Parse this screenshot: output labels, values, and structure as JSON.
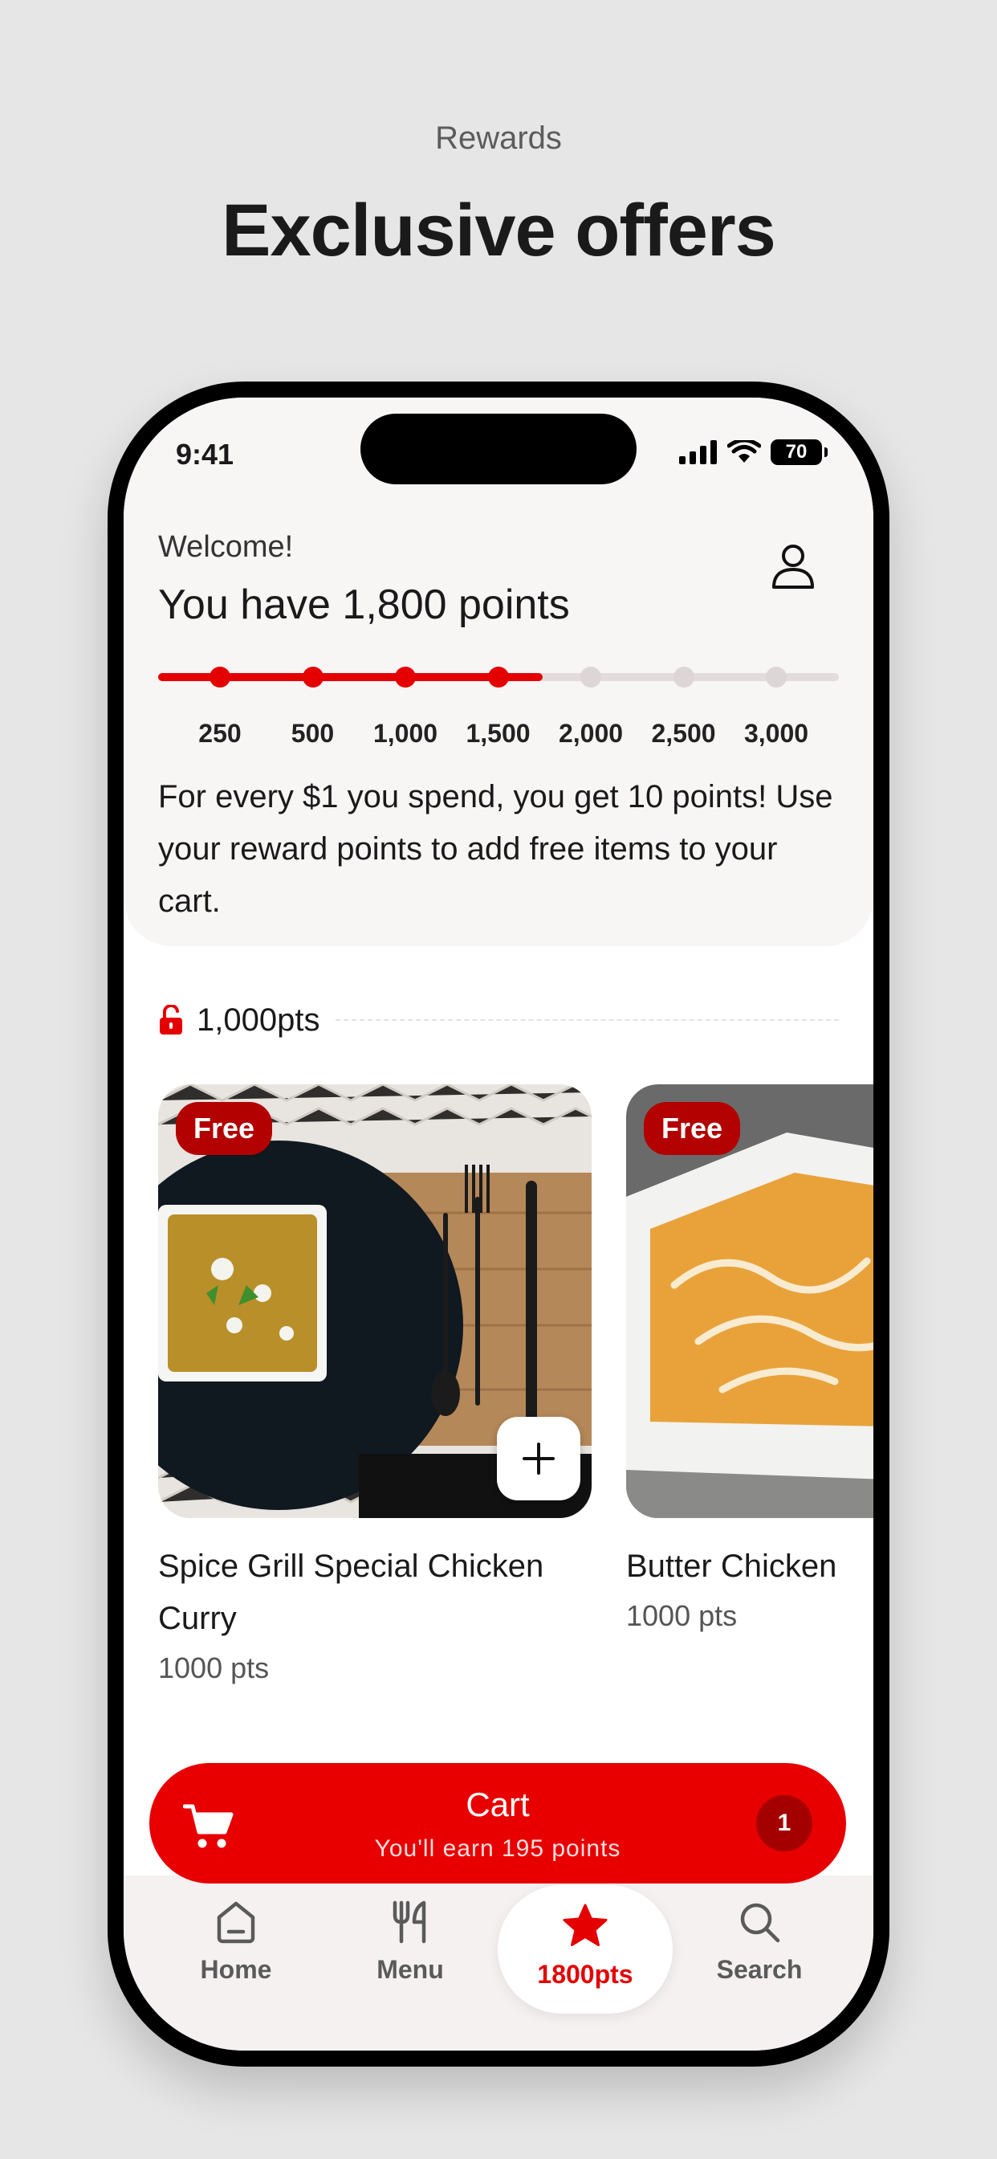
{
  "page": {
    "eyebrow": "Rewards",
    "headline": "Exclusive offers"
  },
  "status_bar": {
    "time": "9:41",
    "battery": "70"
  },
  "header": {
    "welcome": "Welcome!",
    "points_title": "You have 1,800 points",
    "points_value": 1800,
    "progress_fraction": 0.565,
    "milestones": [
      {
        "label": "250",
        "reached": true
      },
      {
        "label": "500",
        "reached": true
      },
      {
        "label": "1,000",
        "reached": true
      },
      {
        "label": "1,500",
        "reached": true
      },
      {
        "label": "2,000",
        "reached": false
      },
      {
        "label": "2,500",
        "reached": false
      },
      {
        "label": "3,000",
        "reached": false
      }
    ],
    "info_text": "For every $1 you spend, you get 10 points! Use your reward points to add free items to your cart."
  },
  "section": {
    "label": "1,000pts",
    "icon": "unlock-icon"
  },
  "items": [
    {
      "badge": "Free",
      "title": "Spice Grill Special Chicken Curry",
      "points": "1000 pts"
    },
    {
      "badge": "Free",
      "title": "Butter Chicken",
      "points": "1000 pts"
    }
  ],
  "cart": {
    "label": "Cart",
    "subtitle": "You'll earn 195 points",
    "count": "1"
  },
  "tabs": [
    {
      "label": "Home",
      "icon": "home-icon",
      "active": false
    },
    {
      "label": "Menu",
      "icon": "utensils-icon",
      "active": false
    },
    {
      "label": "1800pts",
      "icon": "star-icon",
      "active": true
    },
    {
      "label": "Search",
      "icon": "search-icon",
      "active": false
    }
  ],
  "colors": {
    "accent": "#e40000",
    "badge": "#b30000",
    "background": "#e6e6e6"
  }
}
